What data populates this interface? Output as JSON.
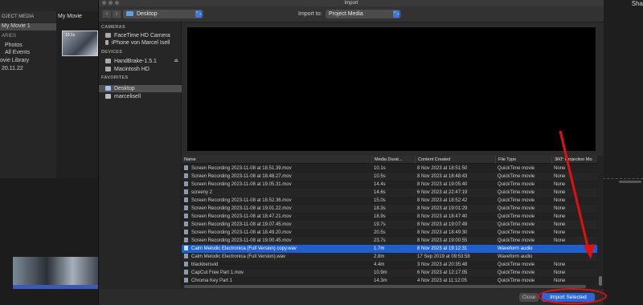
{
  "app": {
    "left_header": "OJECT MEDIA",
    "library_items": [
      "My Movie 1",
      "ARIES",
      "Photos",
      "All Events",
      "ovie Library",
      "20.11.22"
    ],
    "project_title": "My Movie",
    "thumb_label": "10.1s",
    "share_label": "Sha"
  },
  "dialog": {
    "title": "Import",
    "nav_back": "‹",
    "nav_forward": "›",
    "location": "Desktop",
    "import_to_label": "Import to:",
    "import_to_value": "Project Media",
    "chevron": "⌃⌄"
  },
  "sidebar": {
    "cameras_header": "CAMERAS",
    "cameras": [
      "FaceTime HD Camera",
      "iPhone von Marcel Isell"
    ],
    "devices_header": "DEVICES",
    "devices": [
      {
        "label": "HandBrake-1.5.1",
        "eject": "⏏"
      },
      {
        "label": "Macintosh HD",
        "eject": ""
      }
    ],
    "favorites_header": "FAVORITES",
    "favorites": [
      "Desktop",
      "marcelisell"
    ]
  },
  "table": {
    "columns": [
      "Name",
      "Media Durat...",
      "Content Created",
      "File Type",
      "360° Projection Mo"
    ],
    "rows": [
      {
        "name": "Screen Recording 2023-11-08 at 18.51.39.mov",
        "duration": "10.1s",
        "created": "8 Nov 2023 at 18:51:50",
        "type": "QuickTime movie",
        "projection": "None"
      },
      {
        "name": "Screen Recording 2023-11-08 at 18.48.27.mov",
        "duration": "10.5s",
        "created": "8 Nov 2023 at 18:48:43",
        "type": "QuickTime movie",
        "projection": "None"
      },
      {
        "name": "Screen Recording 2023-11-08 at 19.05.31.mov",
        "duration": "14.4s",
        "created": "8 Nov 2023 at 19:05:40",
        "type": "QuickTime movie",
        "projection": "None"
      },
      {
        "name": "screeny 2",
        "duration": "14.6s",
        "created": "6 Nov 2023 at 22:47:19",
        "type": "QuickTime movie",
        "projection": "None"
      },
      {
        "name": "Screen Recording 2023-11-08 at 18.52.36.mov",
        "duration": "15.0s",
        "created": "8 Nov 2023 at 18:52:42",
        "type": "QuickTime movie",
        "projection": "None"
      },
      {
        "name": "Screen Recording 2023-11-08 at 19.01.22.mov",
        "duration": "18.3s",
        "created": "8 Nov 2023 at 19:01:29",
        "type": "QuickTime movie",
        "projection": "None"
      },
      {
        "name": "Screen Recording 2023-11-08 at 18.47.21.mov",
        "duration": "18.9s",
        "created": "8 Nov 2023 at 18:47:40",
        "type": "QuickTime movie",
        "projection": "None"
      },
      {
        "name": "Screen Recording 2023-11-08 at 19.07.45.mov",
        "duration": "19.7s",
        "created": "8 Nov 2023 at 19:07:49",
        "type": "QuickTime movie",
        "projection": "None"
      },
      {
        "name": "Screen Recording 2023-11-08 at 18.49.20.mov",
        "duration": "20.5s",
        "created": "8 Nov 2023 at 18:49:30",
        "type": "QuickTime movie",
        "projection": "None"
      },
      {
        "name": "Screen Recording 2023-11-08 at 19.00.45.mov",
        "duration": "23.7s",
        "created": "8 Nov 2023 at 19:00:55",
        "type": "QuickTime movie",
        "projection": "None"
      },
      {
        "name": "Calm Melodic Electronica (Full Version) copy.wav",
        "duration": "1.7m",
        "created": "8 Nov 2023 at 19:12:31",
        "type": "Waveform audio",
        "projection": ""
      },
      {
        "name": "Calm Melodic Electronica (Full Version).wav",
        "duration": "2.8m",
        "created": "17 Sep 2019 at 09:53:58",
        "type": "Waveform audio",
        "projection": ""
      },
      {
        "name": "blackbersvid",
        "duration": "4.4m",
        "created": "3 Nov 2023 at 20:35:48",
        "type": "QuickTime movie",
        "projection": "None"
      },
      {
        "name": "CapCut Free Part 1.mov",
        "duration": "10.9m",
        "created": "6 Nov 2023 at 12:17:05",
        "type": "QuickTime movie",
        "projection": "None"
      },
      {
        "name": "Chroma Key Part 1",
        "duration": "14.3m",
        "created": "4 Nov 2023 at 11:12:05",
        "type": "QuickTime movie",
        "projection": "None"
      }
    ],
    "selected_index": 10
  },
  "footer": {
    "close_label": "Close",
    "import_label": "Import Selected"
  },
  "colors": {
    "accent": "#2b66d8",
    "selection": "#1f5fd0",
    "annotation": "#e01010"
  }
}
